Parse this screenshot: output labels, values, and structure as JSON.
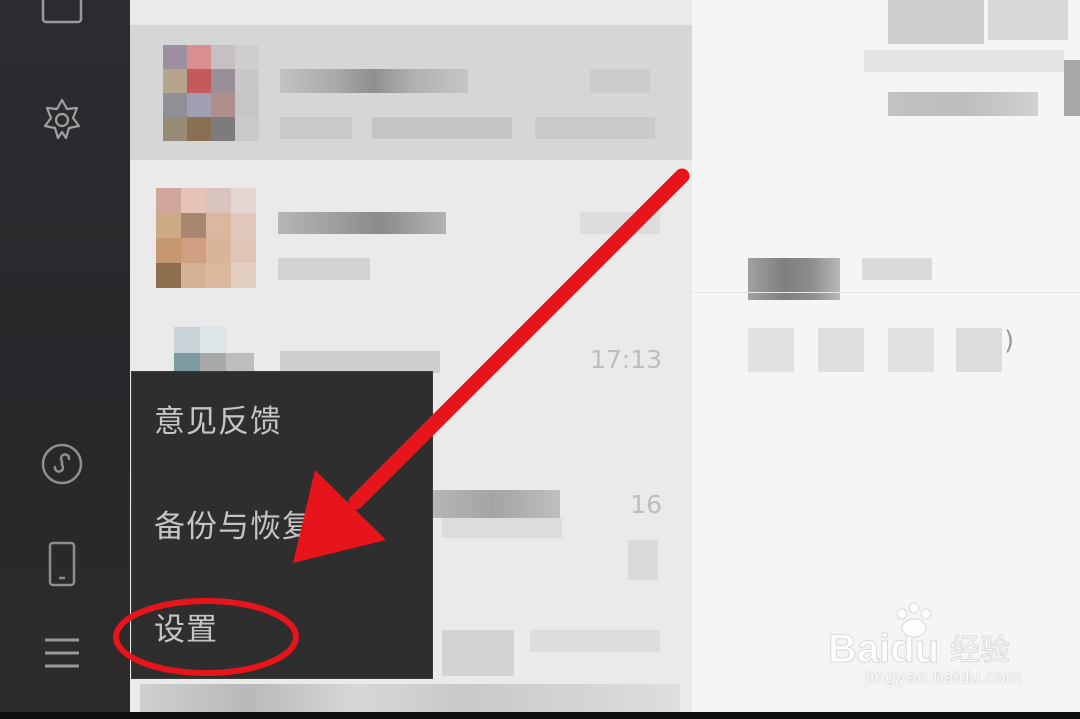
{
  "sidebar": {
    "icons": [
      "window-icon",
      "hexagon-star-icon",
      "mini-program-icon",
      "phone-icon",
      "menu-icon"
    ]
  },
  "chat_list": {
    "times": [
      "17:13",
      "16"
    ]
  },
  "content": {
    "partial_char": ")"
  },
  "menu": {
    "items": [
      "意见反馈",
      "备份与恢复",
      "设置"
    ]
  },
  "annotation": {
    "color": "#e8141b"
  },
  "watermark": {
    "brand": "Baidu",
    "brand_cn": "经验",
    "url": "jingyan.baidu.com"
  }
}
